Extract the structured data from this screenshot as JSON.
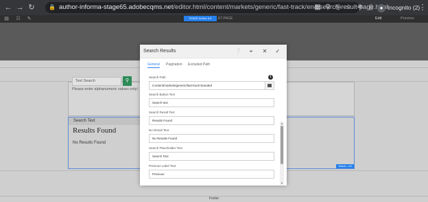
{
  "browser": {
    "url_host": "author-informa-stage65.adobecqms.net",
    "url_path": "/editor.html/content/markets/generic/fast-track/en4/search-result-page.html",
    "profile_label": "Incognito (2)"
  },
  "editor": {
    "chip_label": "STAGE Author 6.5",
    "page_label": "ET-PAGE",
    "edit_label": "Edit",
    "preview_label": "Preview"
  },
  "page": {
    "search_placeholder": "Text Search",
    "hint_text": "Please enter alphanumeric values only!",
    "results_tag": "Search Text",
    "results_title": "Results Found",
    "no_results_text": "No Results Found",
    "results_chip": "Search - 4.8",
    "footer_text": "Footer"
  },
  "dialog": {
    "title": "Search Results",
    "tabs": [
      "General",
      "Pagination",
      "Excluded Path"
    ],
    "active_tab": "General",
    "fields": {
      "search_path_label": "Search Path",
      "search_path_value": "/content/markets/generic/fast-track-branded",
      "search_button_label": "Search Button Text",
      "search_button_value": "Search text",
      "search_result_label": "Search Result Text",
      "search_result_value": "Results Found",
      "no_result_label": "No Result Text",
      "no_result_value": "No Results Found",
      "placeholder_label": "Search Placeholder Text",
      "placeholder_value": "Search Text",
      "previous_label": "Previous Label Text",
      "previous_value": "Previous"
    }
  },
  "colors": {
    "accent": "#2680eb",
    "search_button": "#2e8b57"
  }
}
